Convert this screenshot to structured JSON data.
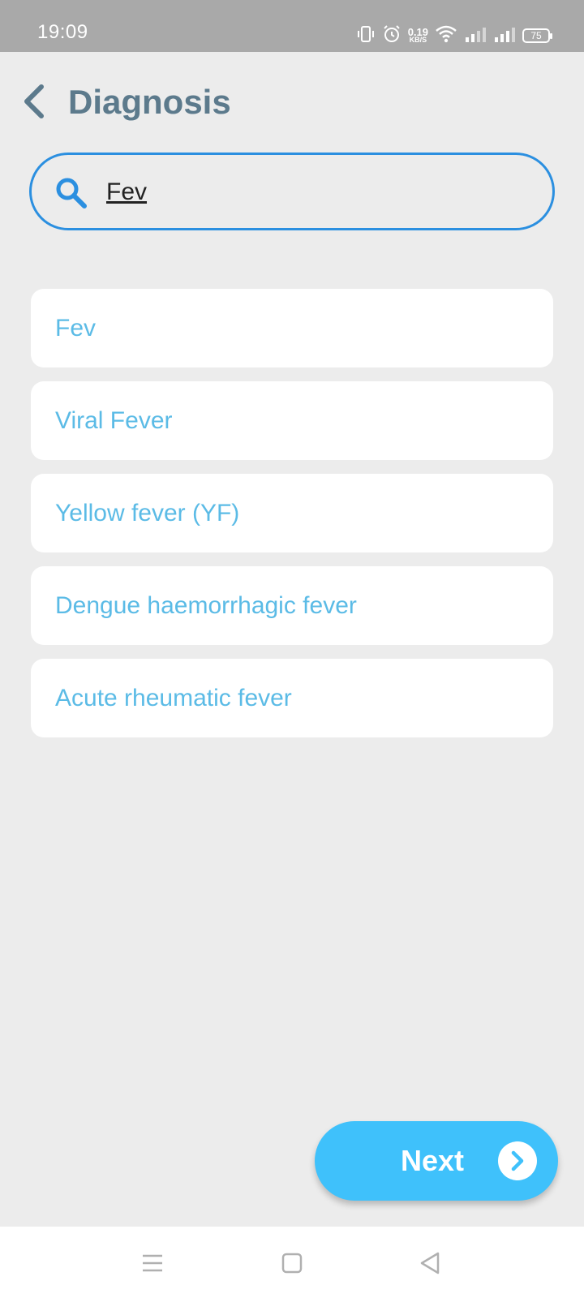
{
  "status_bar": {
    "time": "19:09",
    "net_speed_value": "0.19",
    "net_speed_unit": "KB/S",
    "battery_level": "75"
  },
  "header": {
    "title": "Diagnosis"
  },
  "search": {
    "value": "Fev",
    "accent_color": "#2b8fe0"
  },
  "results": [
    "Fev",
    "Viral Fever",
    "Yellow fever (YF)",
    "Dengue haemorrhagic fever",
    "Acute rheumatic fever"
  ],
  "next_button": {
    "label": "Next",
    "color": "#3fc1fb"
  },
  "icons": {
    "back": "chevron-left-icon",
    "search": "search-icon",
    "next": "chevron-right-icon",
    "nav_menu": "menu-icon",
    "nav_home": "home-square-icon",
    "nav_back": "back-triangle-icon"
  }
}
